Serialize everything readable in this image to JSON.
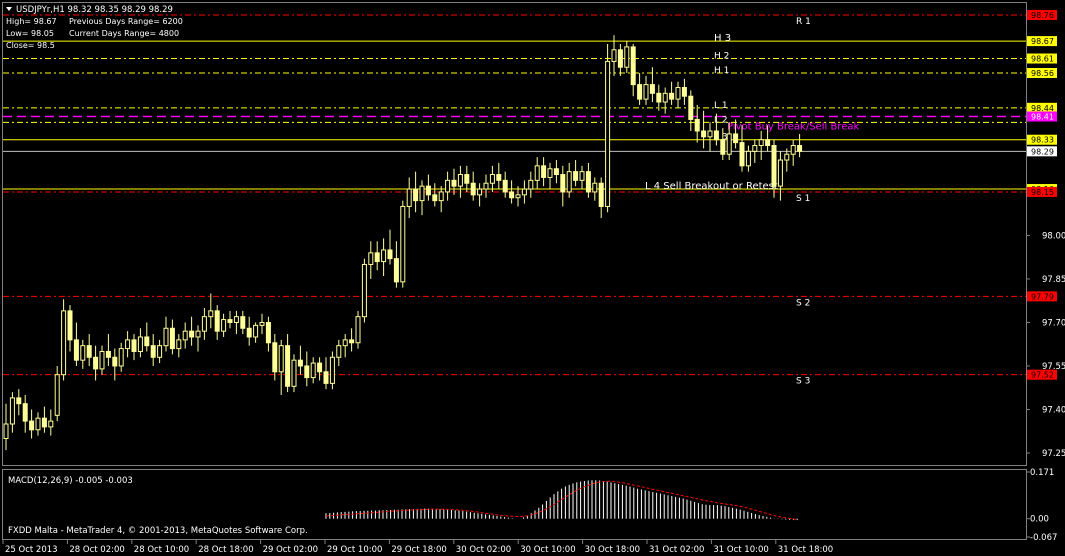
{
  "window": {
    "symbol_title": "USDJPYr,H1  98.32 98.35 98.29 98.29",
    "footer": "FXDD Malta - MetaTrader 4, © 2001-2013, MetaQuotes Software Corp."
  },
  "info_panel": {
    "high": "High= 98.67",
    "low": "Low= 98.05",
    "close": "Close= 98.5",
    "prev_range": "Previous Days Range= 6200",
    "curr_range": "Current Days Range= 4800"
  },
  "colors": {
    "background": "#000000",
    "candle": "#ffff99",
    "resistance_line": "#ff0000",
    "camarilla_line": "#ffff00",
    "pivot_line": "#ff00ff",
    "macd_hist": "#ffffff",
    "macd_signal": "#ff0000",
    "text": "#ffffff"
  },
  "chart_data": {
    "type": "candlestick",
    "price_axis_ticks": [
      "98.00",
      "97.85",
      "97.70",
      "97.55",
      "97.40",
      "97.25"
    ],
    "ylim": [
      97.2,
      98.76
    ],
    "time_axis_labels": [
      "25 Oct 2013",
      "28 Oct 02:00",
      "28 Oct 10:00",
      "28 Oct 18:00",
      "29 Oct 02:00",
      "29 Oct 10:00",
      "29 Oct 18:00",
      "30 Oct 02:00",
      "30 Oct 10:00",
      "30 Oct 18:00",
      "31 Oct 02:00",
      "31 Oct 10:00",
      "31 Oct 18:00"
    ],
    "levels": [
      {
        "name": "R 1",
        "price": 98.76,
        "label": "98.76",
        "kind": "pivot_r",
        "style": "dashdot"
      },
      {
        "name": "H 3",
        "price": 98.67,
        "label": "98.67",
        "kind": "cam",
        "style": "solid"
      },
      {
        "name": "H 2",
        "price": 98.61,
        "label": "98.61",
        "kind": "cam",
        "style": "dashdot"
      },
      {
        "name": "H 1",
        "price": 98.56,
        "label": "98.56",
        "kind": "cam",
        "style": "dashdot"
      },
      {
        "name": "L 1",
        "price": 98.44,
        "label": "98.44",
        "kind": "cam",
        "style": "dashdot"
      },
      {
        "name": "Pivot Buy Break/Sell Break",
        "price": 98.41,
        "label": "98.41",
        "kind": "pivot",
        "style": "dash"
      },
      {
        "name": "L 2",
        "price": 98.39,
        "label": "",
        "kind": "cam",
        "style": "dashdot"
      },
      {
        "name": "L 3",
        "price": 98.33,
        "label": "98.33",
        "kind": "cam",
        "style": "solid"
      },
      {
        "name": "",
        "price": 98.29,
        "label": "98.29",
        "kind": "current",
        "style": "solid"
      },
      {
        "name": "L 4 Sell Breakout or Retest",
        "price": 98.16,
        "label": "98.16",
        "kind": "cam",
        "style": "solid"
      },
      {
        "name": "S 1",
        "price": 98.15,
        "label": "98.15",
        "kind": "pivot_s",
        "style": "dashdot"
      },
      {
        "name": "S 2",
        "price": 97.79,
        "label": "97.79",
        "kind": "pivot_s",
        "style": "dashdot"
      },
      {
        "name": "S 3",
        "price": 97.52,
        "label": "97.52",
        "kind": "pivot_s",
        "style": "dashdot"
      }
    ],
    "macd": {
      "title": "MACD(12,26,9) -0.005 -0.003",
      "axis_ticks": [
        "0.171",
        "0.00",
        "-0.067"
      ],
      "ylim": [
        -0.067,
        0.171
      ]
    },
    "candles": [
      [
        97.3,
        97.42,
        97.26,
        97.35
      ],
      [
        97.35,
        97.46,
        97.32,
        97.44
      ],
      [
        97.44,
        97.47,
        97.38,
        97.42
      ],
      [
        97.42,
        97.45,
        97.32,
        97.36
      ],
      [
        97.36,
        97.4,
        97.3,
        97.33
      ],
      [
        97.33,
        97.39,
        97.31,
        97.37
      ],
      [
        97.37,
        97.41,
        97.32,
        97.34
      ],
      [
        97.34,
        97.4,
        97.31,
        97.36
      ],
      [
        97.38,
        97.55,
        97.36,
        97.52
      ],
      [
        97.52,
        97.78,
        97.5,
        97.74
      ],
      [
        97.74,
        97.76,
        97.6,
        97.64
      ],
      [
        97.64,
        97.7,
        97.55,
        97.57
      ],
      [
        97.57,
        97.64,
        97.54,
        97.62
      ],
      [
        97.62,
        97.66,
        97.55,
        97.58
      ],
      [
        97.58,
        97.62,
        97.5,
        97.54
      ],
      [
        97.54,
        97.62,
        97.52,
        97.6
      ],
      [
        97.6,
        97.66,
        97.55,
        97.58
      ],
      [
        97.58,
        97.61,
        97.5,
        97.55
      ],
      [
        97.55,
        97.63,
        97.53,
        97.61
      ],
      [
        97.61,
        97.67,
        97.58,
        97.64
      ],
      [
        97.64,
        97.66,
        97.57,
        97.6
      ],
      [
        97.6,
        97.68,
        97.58,
        97.65
      ],
      [
        97.65,
        97.7,
        97.6,
        97.62
      ],
      [
        97.62,
        97.66,
        97.55,
        97.58
      ],
      [
        97.58,
        97.64,
        97.56,
        97.62
      ],
      [
        97.62,
        97.72,
        97.6,
        97.68
      ],
      [
        97.68,
        97.71,
        97.59,
        97.61
      ],
      [
        97.61,
        97.66,
        97.58,
        97.64
      ],
      [
        97.64,
        97.7,
        97.61,
        97.67
      ],
      [
        97.67,
        97.72,
        97.62,
        97.65
      ],
      [
        97.65,
        97.69,
        97.6,
        97.67
      ],
      [
        97.67,
        97.75,
        97.64,
        97.72
      ],
      [
        97.72,
        97.8,
        97.68,
        97.74
      ],
      [
        97.74,
        97.76,
        97.64,
        97.67
      ],
      [
        97.67,
        97.73,
        97.65,
        97.71
      ],
      [
        97.71,
        97.74,
        97.68,
        97.7
      ],
      [
        97.7,
        97.74,
        97.66,
        97.72
      ],
      [
        97.72,
        97.74,
        97.66,
        97.68
      ],
      [
        97.68,
        97.72,
        97.62,
        97.65
      ],
      [
        97.65,
        97.7,
        97.63,
        97.69
      ],
      [
        97.69,
        97.73,
        97.66,
        97.7
      ],
      [
        97.7,
        97.72,
        97.6,
        97.63
      ],
      [
        97.63,
        97.66,
        97.5,
        97.53
      ],
      [
        97.53,
        97.64,
        97.45,
        97.62
      ],
      [
        97.62,
        97.66,
        97.46,
        97.48
      ],
      [
        97.48,
        97.59,
        97.46,
        97.57
      ],
      [
        97.57,
        97.62,
        97.52,
        97.55
      ],
      [
        97.55,
        97.6,
        97.48,
        97.51
      ],
      [
        97.51,
        97.58,
        97.49,
        97.56
      ],
      [
        97.56,
        97.58,
        97.5,
        97.53
      ],
      [
        97.53,
        97.58,
        97.47,
        97.49
      ],
      [
        97.49,
        97.6,
        97.47,
        97.58
      ],
      [
        97.58,
        97.64,
        97.55,
        97.62
      ],
      [
        97.62,
        97.66,
        97.58,
        97.64
      ],
      [
        97.64,
        97.68,
        97.6,
        97.63
      ],
      [
        97.63,
        97.74,
        97.61,
        97.72
      ],
      [
        97.72,
        97.92,
        97.7,
        97.9
      ],
      [
        97.9,
        97.98,
        97.85,
        97.94
      ],
      [
        97.94,
        97.98,
        97.88,
        97.91
      ],
      [
        97.91,
        97.99,
        97.86,
        97.95
      ],
      [
        97.95,
        98.02,
        97.9,
        97.92
      ],
      [
        97.92,
        97.98,
        97.82,
        97.84
      ],
      [
        97.84,
        98.12,
        97.82,
        98.1
      ],
      [
        98.1,
        98.2,
        98.06,
        98.16
      ],
      [
        98.16,
        98.22,
        98.08,
        98.12
      ],
      [
        98.12,
        98.19,
        98.07,
        98.17
      ],
      [
        98.17,
        98.21,
        98.12,
        98.14
      ],
      [
        98.14,
        98.18,
        98.1,
        98.12
      ],
      [
        98.12,
        98.17,
        98.08,
        98.15
      ],
      [
        98.15,
        98.22,
        98.12,
        98.19
      ],
      [
        98.19,
        98.23,
        98.14,
        98.17
      ],
      [
        98.17,
        98.24,
        98.13,
        98.21
      ],
      [
        98.21,
        98.24,
        98.15,
        98.18
      ],
      [
        98.18,
        98.22,
        98.12,
        98.14
      ],
      [
        98.14,
        98.18,
        98.1,
        98.16
      ],
      [
        98.16,
        98.21,
        98.13,
        98.18
      ],
      [
        98.18,
        98.24,
        98.15,
        98.21
      ],
      [
        98.21,
        98.25,
        98.16,
        98.19
      ],
      [
        98.19,
        98.22,
        98.13,
        98.15
      ],
      [
        98.15,
        98.19,
        98.11,
        98.13
      ],
      [
        98.13,
        98.17,
        98.1,
        98.14
      ],
      [
        98.14,
        98.19,
        98.11,
        98.16
      ],
      [
        98.16,
        98.22,
        98.13,
        98.19
      ],
      [
        98.19,
        98.27,
        98.16,
        98.24
      ],
      [
        98.24,
        98.27,
        98.17,
        98.2
      ],
      [
        98.2,
        98.25,
        98.16,
        98.23
      ],
      [
        98.23,
        98.26,
        98.18,
        98.21
      ],
      [
        98.21,
        98.24,
        98.1,
        98.15
      ],
      [
        98.15,
        98.25,
        98.13,
        98.22
      ],
      [
        98.22,
        98.26,
        98.17,
        98.19
      ],
      [
        98.19,
        98.24,
        98.16,
        98.22
      ],
      [
        98.22,
        98.25,
        98.13,
        98.15
      ],
      [
        98.15,
        98.2,
        98.12,
        98.18
      ],
      [
        98.18,
        98.2,
        98.06,
        98.1
      ],
      [
        98.1,
        98.66,
        98.08,
        98.6
      ],
      [
        98.6,
        98.69,
        98.55,
        98.64
      ],
      [
        98.64,
        98.66,
        98.55,
        98.58
      ],
      [
        98.58,
        98.67,
        98.56,
        98.65
      ],
      [
        98.65,
        98.66,
        98.48,
        98.52
      ],
      [
        98.52,
        98.56,
        98.45,
        98.47
      ],
      [
        98.47,
        98.55,
        98.45,
        98.52
      ],
      [
        98.52,
        98.58,
        98.46,
        98.49
      ],
      [
        98.49,
        98.52,
        98.43,
        98.46
      ],
      [
        98.46,
        98.51,
        98.42,
        98.49
      ],
      [
        98.49,
        98.53,
        98.45,
        98.47
      ],
      [
        98.47,
        98.53,
        98.44,
        98.51
      ],
      [
        98.51,
        98.54,
        98.45,
        98.48
      ],
      [
        98.48,
        98.5,
        98.36,
        98.4
      ],
      [
        98.4,
        98.45,
        98.32,
        98.36
      ],
      [
        98.36,
        98.43,
        98.3,
        98.34
      ],
      [
        98.34,
        98.39,
        98.29,
        98.36
      ],
      [
        98.36,
        98.42,
        98.31,
        98.33
      ],
      [
        98.33,
        98.37,
        98.26,
        98.28
      ],
      [
        98.28,
        98.39,
        98.26,
        98.35
      ],
      [
        98.35,
        98.4,
        98.3,
        98.32
      ],
      [
        98.32,
        98.38,
        98.22,
        98.24
      ],
      [
        98.24,
        98.31,
        98.22,
        98.29
      ],
      [
        98.29,
        98.33,
        98.25,
        98.31
      ],
      [
        98.31,
        98.36,
        98.26,
        98.33
      ],
      [
        98.33,
        98.38,
        98.29,
        98.31
      ],
      [
        98.31,
        98.33,
        98.13,
        98.17
      ],
      [
        98.17,
        98.29,
        98.12,
        98.26
      ],
      [
        98.26,
        98.3,
        98.22,
        98.28
      ],
      [
        98.28,
        98.33,
        98.24,
        98.31
      ],
      [
        98.31,
        98.35,
        98.27,
        98.29
      ]
    ],
    "macd_hist": [
      0.02,
      0.021,
      0.022,
      0.023,
      0.024,
      0.025,
      0.026,
      0.027,
      0.028,
      0.028,
      0.029,
      0.029,
      0.03,
      0.03,
      0.031,
      0.031,
      0.032,
      0.032,
      0.033,
      0.033,
      0.034,
      0.034,
      0.035,
      0.035,
      0.036,
      0.036,
      0.037,
      0.037,
      0.037,
      0.036,
      0.035,
      0.034,
      0.033,
      0.032,
      0.031,
      0.03,
      0.028,
      0.026,
      0.024,
      0.022,
      0.02,
      0.018,
      0.016,
      0.014,
      0.012,
      0.01,
      0.008,
      0.006,
      0.004,
      0.002,
      0.0,
      0.0,
      0.005,
      0.01,
      0.02,
      0.03,
      0.04,
      0.052,
      0.065,
      0.078,
      0.09,
      0.1,
      0.11,
      0.118,
      0.124,
      0.129,
      0.133,
      0.136,
      0.138,
      0.14,
      0.141,
      0.141,
      0.14,
      0.138,
      0.136,
      0.133,
      0.13,
      0.127,
      0.124,
      0.121,
      0.118,
      0.114,
      0.11,
      0.107,
      0.104,
      0.101,
      0.098,
      0.095,
      0.092,
      0.089,
      0.086,
      0.083,
      0.08,
      0.077,
      0.074,
      0.07,
      0.066,
      0.061,
      0.057,
      0.053,
      0.051,
      0.05,
      0.05,
      0.05,
      0.048,
      0.046,
      0.043,
      0.04,
      0.037,
      0.033,
      0.029,
      0.025,
      0.021,
      0.017,
      0.013,
      0.01,
      0.007,
      0.004,
      0.001,
      -0.001,
      -0.002,
      -0.003,
      -0.004,
      -0.005,
      -0.005
    ],
    "macd_signal": [
      0.01,
      0.011,
      0.012,
      0.013,
      0.014,
      0.015,
      0.016,
      0.017,
      0.018,
      0.019,
      0.02,
      0.021,
      0.022,
      0.023,
      0.024,
      0.025,
      0.026,
      0.027,
      0.028,
      0.029,
      0.03,
      0.031,
      0.032,
      0.032,
      0.033,
      0.033,
      0.034,
      0.034,
      0.035,
      0.035,
      0.035,
      0.035,
      0.034,
      0.034,
      0.033,
      0.032,
      0.031,
      0.029,
      0.028,
      0.026,
      0.024,
      0.022,
      0.02,
      0.018,
      0.016,
      0.014,
      0.012,
      0.011,
      0.01,
      0.009,
      0.008,
      0.008,
      0.009,
      0.011,
      0.014,
      0.018,
      0.023,
      0.029,
      0.036,
      0.044,
      0.052,
      0.061,
      0.07,
      0.079,
      0.088,
      0.096,
      0.104,
      0.111,
      0.117,
      0.122,
      0.127,
      0.131,
      0.134,
      0.136,
      0.137,
      0.137,
      0.136,
      0.134,
      0.132,
      0.129,
      0.126,
      0.123,
      0.12,
      0.117,
      0.114,
      0.111,
      0.108,
      0.105,
      0.102,
      0.099,
      0.096,
      0.093,
      0.09,
      0.087,
      0.084,
      0.081,
      0.078,
      0.075,
      0.072,
      0.069,
      0.066,
      0.063,
      0.061,
      0.058,
      0.056,
      0.054,
      0.052,
      0.05,
      0.048,
      0.045,
      0.042,
      0.039,
      0.035,
      0.031,
      0.027,
      0.023,
      0.019,
      0.015,
      0.011,
      0.008,
      0.005,
      0.003,
      0.001,
      -0.001,
      -0.003
    ]
  }
}
